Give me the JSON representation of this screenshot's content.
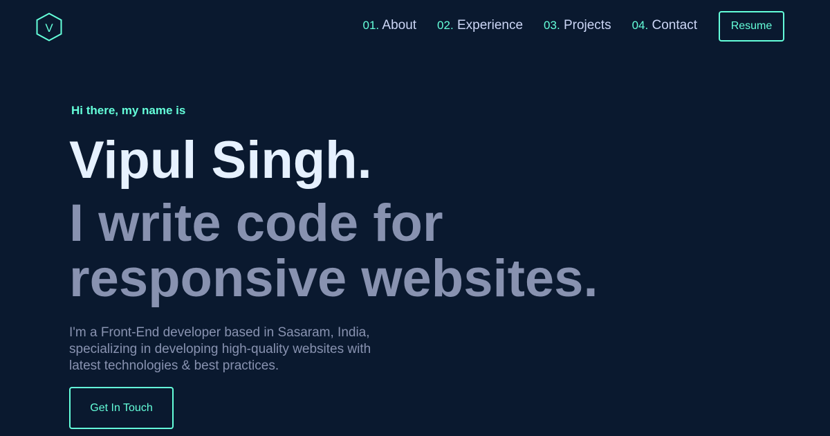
{
  "colors": {
    "background": "#0a192f",
    "accent": "#64ffda",
    "heading": "#e6f1ff",
    "nav_text": "#ccd6f6",
    "muted": "#8892b0"
  },
  "header": {
    "logo_letter": "V",
    "logo_icon": "hexagon-logo-icon",
    "nav": [
      {
        "num": "01.",
        "label": "About"
      },
      {
        "num": "02.",
        "label": "Experience"
      },
      {
        "num": "03.",
        "label": "Projects"
      },
      {
        "num": "04.",
        "label": "Contact"
      }
    ],
    "resume_label": "Resume"
  },
  "hero": {
    "greeting": "Hi there, my name is",
    "name": "Vipul Singh.",
    "tagline": "I write code for responsive websites.",
    "description": "I'm a Front-End developer based in Sasaram, India, specializing in developing high-quality websites with latest technologies & best practices.",
    "cta_label": "Get In Touch"
  }
}
